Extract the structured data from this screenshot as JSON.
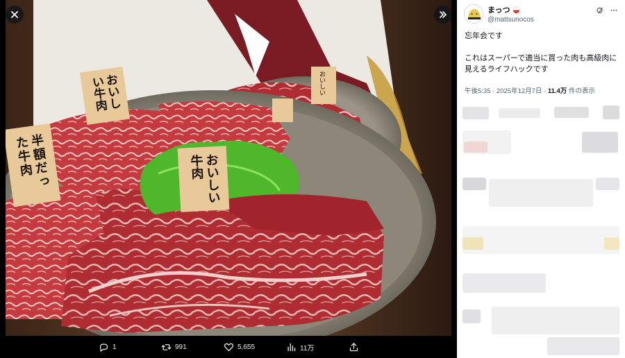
{
  "viewer": {
    "close_icon": "close-icon",
    "expand_icon": "chevrons-right-icon",
    "photo": {
      "left_card": "半額だった牛肉",
      "top_card": "おいしい牛肉",
      "middle_card": "おいしい牛肉",
      "back_card": "おいしい"
    }
  },
  "actions": {
    "reply": {
      "icon": "reply-icon",
      "count": "1"
    },
    "repost": {
      "icon": "repost-icon",
      "count": "991"
    },
    "like": {
      "icon": "heart-icon",
      "count": "5,655"
    },
    "views": {
      "icon": "views-icon",
      "count": "11万"
    },
    "share": {
      "icon": "share-icon"
    }
  },
  "post": {
    "display_name": "まっつ",
    "handle": "@mattsunocos",
    "line1": "忘年会です",
    "line2": "これはスーパーで適当に買った肉も高級肉に見えるライフハックです",
    "time": "午後5:35 · 2025年12月7日 · ",
    "views_count": "11.4万",
    "views_suffix": " 件の表示"
  },
  "colors": {
    "accent_red": "#d63b3b",
    "sidebar_bg": "#ffffff",
    "text_secondary": "#536471"
  }
}
